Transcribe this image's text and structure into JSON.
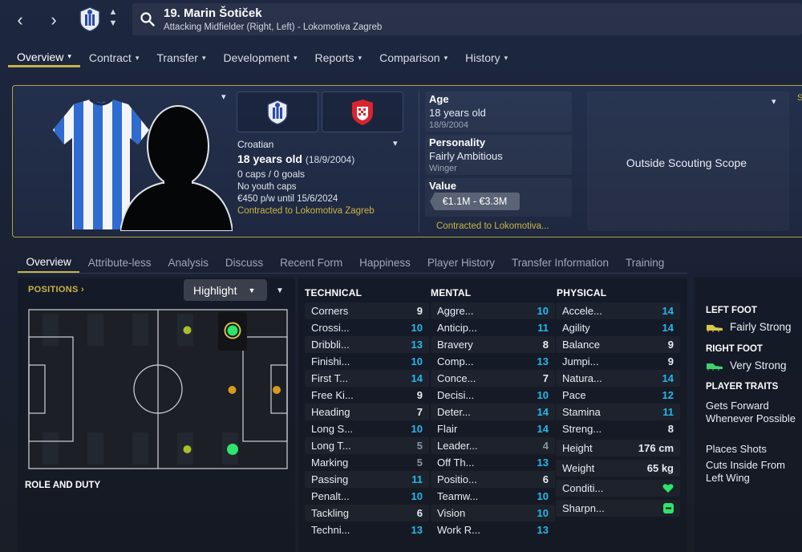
{
  "header": {
    "player_name": "19. Marin Šotiček",
    "player_sub": "Attacking Midfielder (Right, Left) - Lokomotiva Zagreb"
  },
  "main_tabs": [
    {
      "label": "Overview"
    },
    {
      "label": "Contract"
    },
    {
      "label": "Transfer"
    },
    {
      "label": "Development"
    },
    {
      "label": "Reports"
    },
    {
      "label": "Comparison"
    },
    {
      "label": "History"
    }
  ],
  "profile": {
    "nationality": "Croatian",
    "age_main": "18 years old",
    "dob_paren": "(18/9/2004)",
    "caps": "0 caps / 0 goals",
    "youth_caps": "No youth caps",
    "wage": "€450 p/w until 15/6/2024",
    "contracted": "Contracted to Lokomotiva Zagreb"
  },
  "info_cards": {
    "age_label": "Age",
    "age_value": "18 years old",
    "age_dob": "18/9/2004",
    "personality_label": "Personality",
    "personality_value": "Fairly Ambitious",
    "personality_sub": "Winger",
    "value_label": "Value",
    "value_range": "€1.1M - €3.3M",
    "contract_short": "Contracted to Lokomotiva..."
  },
  "scouting": {
    "text": "Outside Scouting Scope",
    "edge_letter": "S"
  },
  "sub_tabs": [
    {
      "label": "Overview"
    },
    {
      "label": "Attribute-less"
    },
    {
      "label": "Analysis"
    },
    {
      "label": "Discuss"
    },
    {
      "label": "Recent Form"
    },
    {
      "label": "Happiness"
    },
    {
      "label": "Player History"
    },
    {
      "label": "Transfer Information"
    },
    {
      "label": "Training"
    }
  ],
  "positions_panel": {
    "positions_label": "POSITIONS",
    "highlight_label": "Highlight",
    "role_label": "ROLE AND DUTY"
  },
  "attributes": {
    "technical_head": "TECHNICAL",
    "mental_head": "MENTAL",
    "physical_head": "PHYSICAL",
    "technical": [
      {
        "name": "Corners",
        "value": "9"
      },
      {
        "name": "Crossi...",
        "value": "10"
      },
      {
        "name": "Dribbli...",
        "value": "13"
      },
      {
        "name": "Finishi...",
        "value": "10"
      },
      {
        "name": "First T...",
        "value": "14"
      },
      {
        "name": "Free Ki...",
        "value": "9"
      },
      {
        "name": "Heading",
        "value": "7"
      },
      {
        "name": "Long S...",
        "value": "10"
      },
      {
        "name": "Long T...",
        "value": "5"
      },
      {
        "name": "Marking",
        "value": "5"
      },
      {
        "name": "Passing",
        "value": "11"
      },
      {
        "name": "Penalt...",
        "value": "10"
      },
      {
        "name": "Tackling",
        "value": "6"
      },
      {
        "name": "Techni...",
        "value": "13"
      }
    ],
    "mental": [
      {
        "name": "Aggre...",
        "value": "10"
      },
      {
        "name": "Anticip...",
        "value": "11"
      },
      {
        "name": "Bravery",
        "value": "8"
      },
      {
        "name": "Comp...",
        "value": "13"
      },
      {
        "name": "Conce...",
        "value": "7"
      },
      {
        "name": "Decisi...",
        "value": "10"
      },
      {
        "name": "Deter...",
        "value": "14"
      },
      {
        "name": "Flair",
        "value": "14"
      },
      {
        "name": "Leader...",
        "value": "4"
      },
      {
        "name": "Off Th...",
        "value": "13"
      },
      {
        "name": "Positio...",
        "value": "6"
      },
      {
        "name": "Teamw...",
        "value": "10"
      },
      {
        "name": "Vision",
        "value": "10"
      },
      {
        "name": "Work R...",
        "value": "13"
      }
    ],
    "physical": [
      {
        "name": "Accele...",
        "value": "14"
      },
      {
        "name": "Agility",
        "value": "14"
      },
      {
        "name": "Balance",
        "value": "9"
      },
      {
        "name": "Jumpi...",
        "value": "9"
      },
      {
        "name": "Natura...",
        "value": "14"
      },
      {
        "name": "Pace",
        "value": "12"
      },
      {
        "name": "Stamina",
        "value": "11"
      },
      {
        "name": "Streng...",
        "value": "8"
      }
    ],
    "height_label": "Height",
    "height_value": "176 cm",
    "weight_label": "Weight",
    "weight_value": "65 kg",
    "condition_label": "Conditi...",
    "sharpness_label": "Sharpn..."
  },
  "right_panel": {
    "left_foot_label": "LEFT FOOT",
    "left_foot_value": "Fairly Strong",
    "right_foot_label": "RIGHT FOOT",
    "right_foot_value": "Very Strong",
    "traits_label": "PLAYER TRAITS",
    "traits": [
      "Gets Forward Whenever Possible",
      "Places Shots",
      "Cuts Inside From Left Wing"
    ]
  },
  "colors": {
    "accent_gold": "#c6b24a",
    "attr_high": "#27b7e8",
    "position_green": "#2ee56b",
    "position_amber": "#d89a1c",
    "position_lime": "#a9c02a"
  }
}
